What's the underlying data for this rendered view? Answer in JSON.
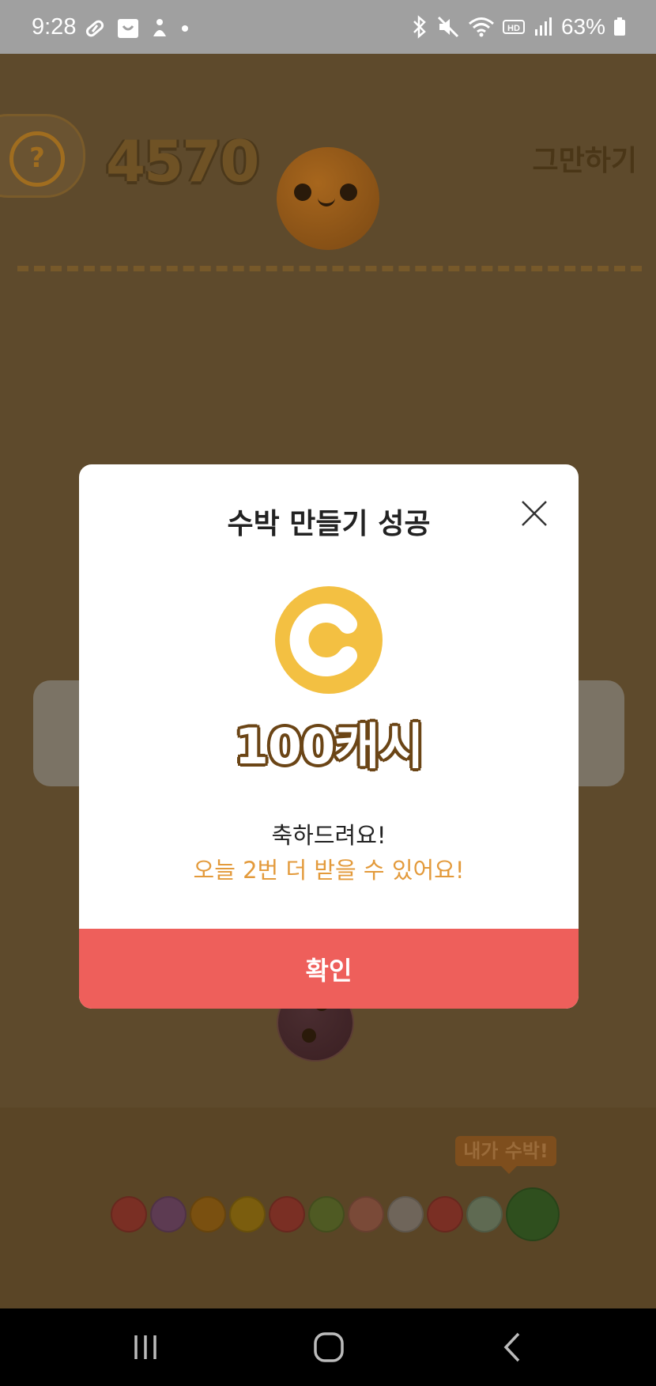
{
  "status_bar": {
    "time": "9:28",
    "battery": "63%",
    "left_icons": [
      "pill-icon",
      "shopping-bag-icon",
      "app-icon",
      "dot-icon"
    ],
    "right_icons": [
      "bluetooth-icon",
      "mute-icon",
      "wifi-icon",
      "hd-voice-icon",
      "signal-icon",
      "battery-icon"
    ]
  },
  "game": {
    "help_symbol": "?",
    "score": "4570",
    "quit_label": "그만하기",
    "tooltip": "내가 수박!",
    "evolution_colors": [
      "#7a2f24",
      "#5d3b52",
      "#7a5010",
      "#7b5d0e",
      "#7a2f24",
      "#4f5a23",
      "#7a4a38",
      "#6f655a",
      "#7a2f24",
      "#5f6a52",
      "#2f4f1e"
    ]
  },
  "modal": {
    "title": "수박 만들기 성공",
    "close_icon": "close-icon",
    "coin_letter": "C",
    "reward": "100캐시",
    "congrats": "축하드려요!",
    "remaining": "오늘 2번 더 받을 수 있어요!",
    "confirm_label": "확인"
  },
  "colors": {
    "overlay_bg": "#5e4a2c",
    "coin": "#f3c042",
    "accent_text": "#e39a3b",
    "confirm_button": "#ee5f5b"
  },
  "nav_bar": {
    "buttons": [
      "recents-icon",
      "home-icon",
      "back-icon"
    ]
  }
}
